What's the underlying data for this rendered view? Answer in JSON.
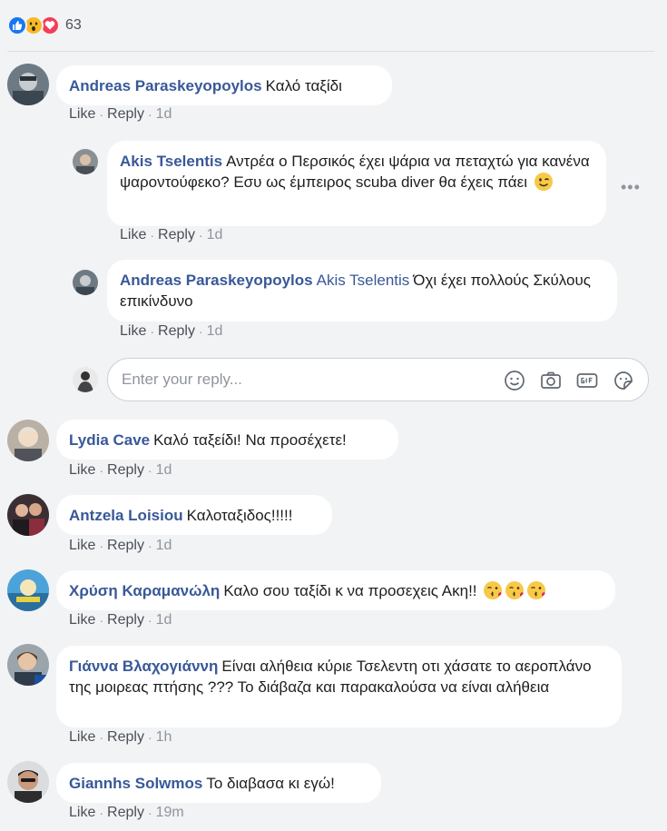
{
  "reactions": {
    "icons": [
      "like-icon",
      "wow-icon",
      "love-icon"
    ],
    "count": "63"
  },
  "colors": {
    "link": "#385898",
    "meta": "#90949c",
    "background": "#f2f3f5",
    "bubble": "#ffffff"
  },
  "actions": {
    "like": "Like",
    "reply": "Reply",
    "sep": "·"
  },
  "comments": [
    {
      "author": "Andreas Paraskeyopoylos",
      "text": "Καλό ταξίδι",
      "time": "1d"
    },
    {
      "author": "Akis Tselentis",
      "text": "Αντρέα ο Περσικός έχει ψάρια να πεταχτώ για κανένα ψαροντούφεκο? Εσυ ως έμπειρος scuba diver θα έχεις πάει",
      "emoji": "wink-emoji",
      "time": "1d"
    },
    {
      "author": "Andreas Paraskeyopoylos",
      "mention": "Akis Tselentis",
      "text": "Όχι έχει πολλούς Σκύλους επικίνδυνο",
      "time": "1d"
    },
    {
      "author": "Lydia Cave",
      "text": "Καλό ταξείδι! Να προσέχετε!",
      "time": "1d"
    },
    {
      "author": "Antzela Loisiou",
      "text": "Καλοταξιδος!!!!!",
      "time": "1d"
    },
    {
      "author": "Χρύση Καραμανώλη",
      "text": "Καλο σου ταξίδι κ να προσεχεις Ακη!!",
      "emoji": "kiss-emoji",
      "time": "1d"
    },
    {
      "author": "Γιάννα Βλαχογιάννη",
      "text": "Είναι αλήθεια κύριε Τσελεντη οτι χάσατε το αεροπλάνο της μοιρεας πτήσης ??? Το διάβαζα και παρακαλούσα να είναι αλήθεια",
      "time": "1h"
    },
    {
      "author": "Giannhs Solwmos",
      "text": "Το διαβασα κι εγώ!",
      "time": "19m"
    }
  ],
  "reply_box": {
    "placeholder": "Enter your reply...",
    "icons": [
      "emoji-icon",
      "camera-icon",
      "gif-icon",
      "sticker-icon"
    ]
  }
}
